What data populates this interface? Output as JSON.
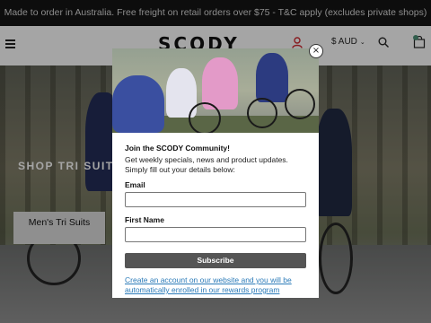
{
  "announcement": "Made to order in Australia. Free freight on retail orders over $75 - T&C apply (excludes private shops)",
  "header": {
    "logo": "SCODY",
    "currency": "$ AUD",
    "icons": [
      "menu-icon",
      "user-icon",
      "chevron-down-icon",
      "search-icon",
      "cart-icon"
    ]
  },
  "hero": {
    "title": "SHOP TRI SUITS. R",
    "button_label": "Men's Tri Suits"
  },
  "popup": {
    "heading": "Join the SCODY Community!",
    "text": "Get weekly specials, news and product updates. Simply fill out your details below:",
    "email_label": "Email",
    "email_value": "",
    "name_label": "First Name",
    "name_value": "",
    "subscribe_label": "Subscribe",
    "link_text": "Create an account on our website and you will be automatically enrolled in our rewards program",
    "close_glyph": "×"
  },
  "colors": {
    "announcement_bg": "#141414",
    "header_bg": "#f4f4f4",
    "subscribe_bg": "#555555",
    "link": "#2a7ab8",
    "user_icon": "#c8272d",
    "cart_badge": "#4a8a72"
  }
}
